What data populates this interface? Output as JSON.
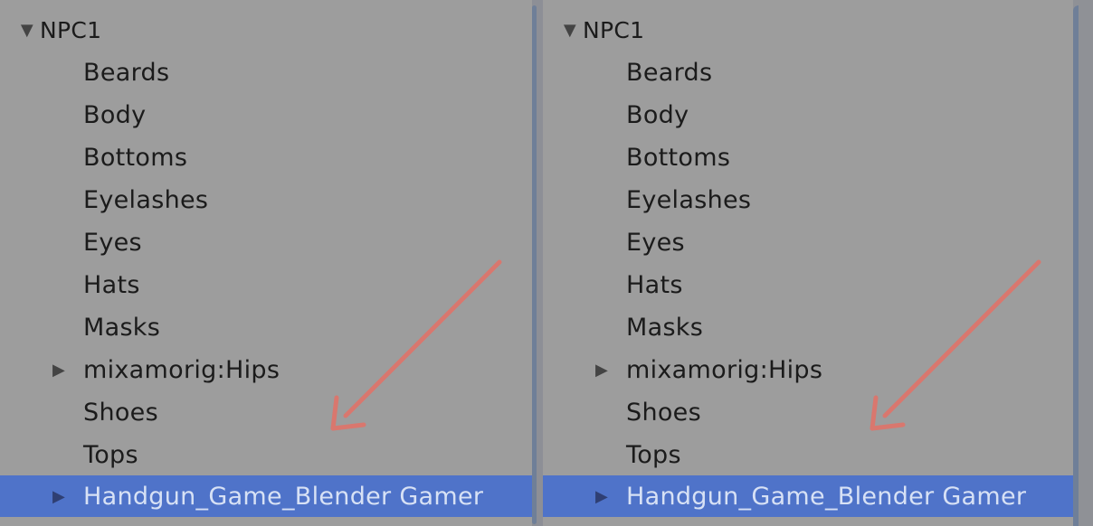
{
  "panels": [
    {
      "root_label": "NPC1",
      "items": [
        {
          "label": "Beards",
          "expander": false
        },
        {
          "label": "Body",
          "expander": false
        },
        {
          "label": "Bottoms",
          "expander": false
        },
        {
          "label": "Eyelashes",
          "expander": false
        },
        {
          "label": "Eyes",
          "expander": false
        },
        {
          "label": "Hats",
          "expander": false
        },
        {
          "label": "Masks",
          "expander": false
        },
        {
          "label": "mixamorig:Hips",
          "expander": true
        },
        {
          "label": "Shoes",
          "expander": false
        },
        {
          "label": "Tops",
          "expander": false
        }
      ],
      "selected_label": "Handgun_Game_Blender Gamer"
    },
    {
      "root_label": "NPC1",
      "items": [
        {
          "label": "Beards",
          "expander": false
        },
        {
          "label": "Body",
          "expander": false
        },
        {
          "label": "Bottoms",
          "expander": false
        },
        {
          "label": "Eyelashes",
          "expander": false
        },
        {
          "label": "Eyes",
          "expander": false
        },
        {
          "label": "Hats",
          "expander": false
        },
        {
          "label": "Masks",
          "expander": false
        },
        {
          "label": "mixamorig:Hips",
          "expander": true
        },
        {
          "label": "Shoes",
          "expander": false
        },
        {
          "label": "Tops",
          "expander": false
        }
      ],
      "selected_label": "Handgun_Game_Blender Gamer"
    }
  ],
  "colors": {
    "background": "#9d9d9d",
    "selection": "#4f73c9",
    "annotation_arrow": "#d9776e"
  }
}
